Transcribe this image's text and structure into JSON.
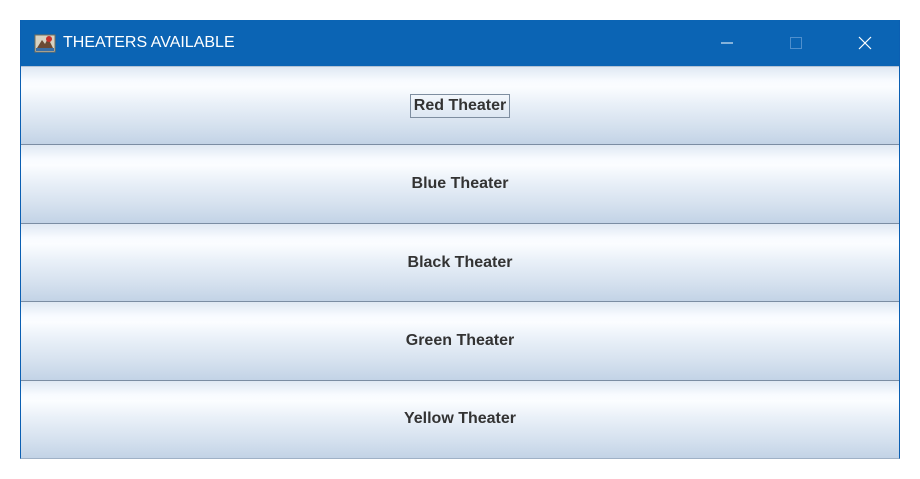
{
  "window": {
    "title": "THEATERS AVAILABLE",
    "app_icon": "java-app-icon",
    "controls": {
      "minimize_icon": "minimize-icon",
      "maximize_icon": "maximize-icon",
      "close_icon": "close-icon"
    },
    "colors": {
      "titlebar": "#0b64b4",
      "title_text": "#ffffff",
      "button_text": "#333333"
    }
  },
  "theaters": [
    {
      "label": "Red Theater",
      "focused": true
    },
    {
      "label": "Blue Theater",
      "focused": false
    },
    {
      "label": "Black Theater",
      "focused": false
    },
    {
      "label": "Green Theater",
      "focused": false
    },
    {
      "label": "Yellow Theater",
      "focused": false
    }
  ]
}
